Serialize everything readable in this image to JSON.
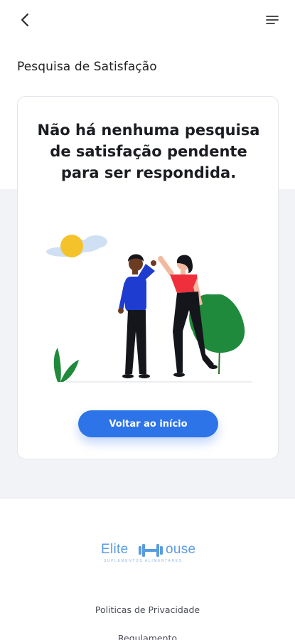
{
  "header": {
    "back_icon": "chevron-left-icon",
    "menu_icon": "hamburger-menu-icon"
  },
  "page": {
    "title": "Pesquisa de Satisfação"
  },
  "card": {
    "message": "Não há nenhuma pesquisa de satisfação pendente para ser respondida.",
    "illustration": "high-five-illustration",
    "cta_label": "Voltar ao início"
  },
  "footer": {
    "logo_left": "Elite",
    "logo_right": "ouse",
    "logo_tagline": "SUPLEMENTOS ALIMENTARES",
    "links": [
      "Politicas de Privacidade",
      "Regulamento"
    ]
  },
  "colors": {
    "accent": "#2d74e8",
    "logo": "#5a9ce0",
    "background_mid": "#f2f3f6"
  }
}
